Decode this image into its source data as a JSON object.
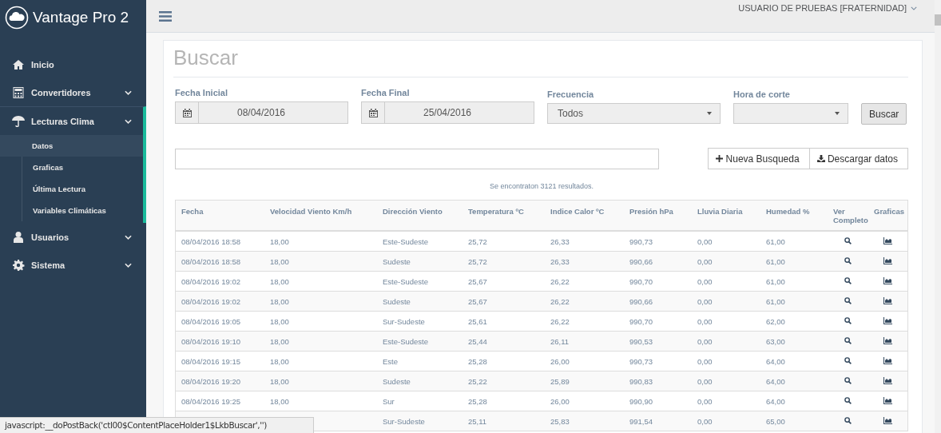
{
  "app": {
    "title": "Vantage Pro 2"
  },
  "sidebar": {
    "items": [
      {
        "label": "Inicio",
        "kind": "link"
      },
      {
        "label": "Convertidores",
        "kind": "group",
        "expanded": false
      },
      {
        "label": "Lecturas Clima",
        "kind": "group",
        "expanded": true,
        "children": [
          {
            "label": "Datos",
            "selected": true
          },
          {
            "label": "Graficas",
            "selected": false
          },
          {
            "label": "Última Lectura",
            "selected": false
          },
          {
            "label": "Variables Climáticas",
            "selected": false
          }
        ]
      },
      {
        "label": "Usuarios",
        "kind": "group",
        "expanded": false
      },
      {
        "label": "Sistema",
        "kind": "group",
        "expanded": false
      }
    ]
  },
  "topbar": {
    "user": "USUARIO DE PRUEBAS [FRATERNIDAD]"
  },
  "page": {
    "title": "Buscar"
  },
  "form": {
    "fecha_inicial": {
      "label": "Fecha Inicial",
      "value": "08/04/2016"
    },
    "fecha_final": {
      "label": "Fecha Final",
      "value": "25/04/2016"
    },
    "frecuencia": {
      "label": "Frecuencia",
      "value": "Todos"
    },
    "hora_corte": {
      "label": "Hora de corte"
    },
    "buscar_button": "Buscar"
  },
  "actions": {
    "nueva_busqueda": "Nueva Busqueda",
    "descargar": "Descargar datos"
  },
  "results_text": "Se encontraton 3121 resultados.",
  "table": {
    "columns": [
      "Fecha",
      "Velocidad Viento Km/h",
      "Dirección Viento",
      "Temperatura ºC",
      "Indice Calor ºC",
      "Presión hPa",
      "Lluvia Diaria",
      "Humedad %",
      "Ver Completo",
      "Graficas"
    ],
    "rows": [
      {
        "fecha": "08/04/2016 18:58",
        "velocidad": "18,00",
        "direccion": "Este-Sudeste",
        "temperatura": "25,72",
        "indice_calor": "26,33",
        "presion": "990,73",
        "lluvia": "0,00",
        "humedad": "61,00"
      },
      {
        "fecha": "08/04/2016 18:58",
        "velocidad": "18,00",
        "direccion": "Sudeste",
        "temperatura": "25,72",
        "indice_calor": "26,33",
        "presion": "990,66",
        "lluvia": "0,00",
        "humedad": "61,00"
      },
      {
        "fecha": "08/04/2016 19:02",
        "velocidad": "18,00",
        "direccion": "Este-Sudeste",
        "temperatura": "25,67",
        "indice_calor": "26,22",
        "presion": "990,70",
        "lluvia": "0,00",
        "humedad": "61,00"
      },
      {
        "fecha": "08/04/2016 19:02",
        "velocidad": "18,00",
        "direccion": "Sudeste",
        "temperatura": "25,67",
        "indice_calor": "26,22",
        "presion": "990,66",
        "lluvia": "0,00",
        "humedad": "61,00"
      },
      {
        "fecha": "08/04/2016 19:05",
        "velocidad": "18,00",
        "direccion": "Sur-Sudeste",
        "temperatura": "25,61",
        "indice_calor": "26,22",
        "presion": "990,70",
        "lluvia": "0,00",
        "humedad": "62,00"
      },
      {
        "fecha": "08/04/2016 19:10",
        "velocidad": "18,00",
        "direccion": "Este-Sudeste",
        "temperatura": "25,44",
        "indice_calor": "26,11",
        "presion": "990,53",
        "lluvia": "0,00",
        "humedad": "63,00"
      },
      {
        "fecha": "08/04/2016 19:15",
        "velocidad": "18,00",
        "direccion": "Este",
        "temperatura": "25,28",
        "indice_calor": "26,00",
        "presion": "990,73",
        "lluvia": "0,00",
        "humedad": "64,00"
      },
      {
        "fecha": "08/04/2016 19:20",
        "velocidad": "18,00",
        "direccion": "Sudeste",
        "temperatura": "25,22",
        "indice_calor": "25,89",
        "presion": "990,83",
        "lluvia": "0,00",
        "humedad": "64,00"
      },
      {
        "fecha": "08/04/2016 19:25",
        "velocidad": "18,00",
        "direccion": "Sur",
        "temperatura": "25,28",
        "indice_calor": "26,00",
        "presion": "990,90",
        "lluvia": "0,00",
        "humedad": "64,00"
      },
      {
        "direccion": "Sur-Sudeste",
        "temperatura": "25,11",
        "indice_calor": "25,83",
        "presion": "991,54",
        "lluvia": "0,00",
        "humedad": "65,00"
      }
    ]
  },
  "status_bar": {
    "text": "javascript:__doPostBack('ctl00$ContentPlaceHolder1$LkbBuscar','')"
  }
}
